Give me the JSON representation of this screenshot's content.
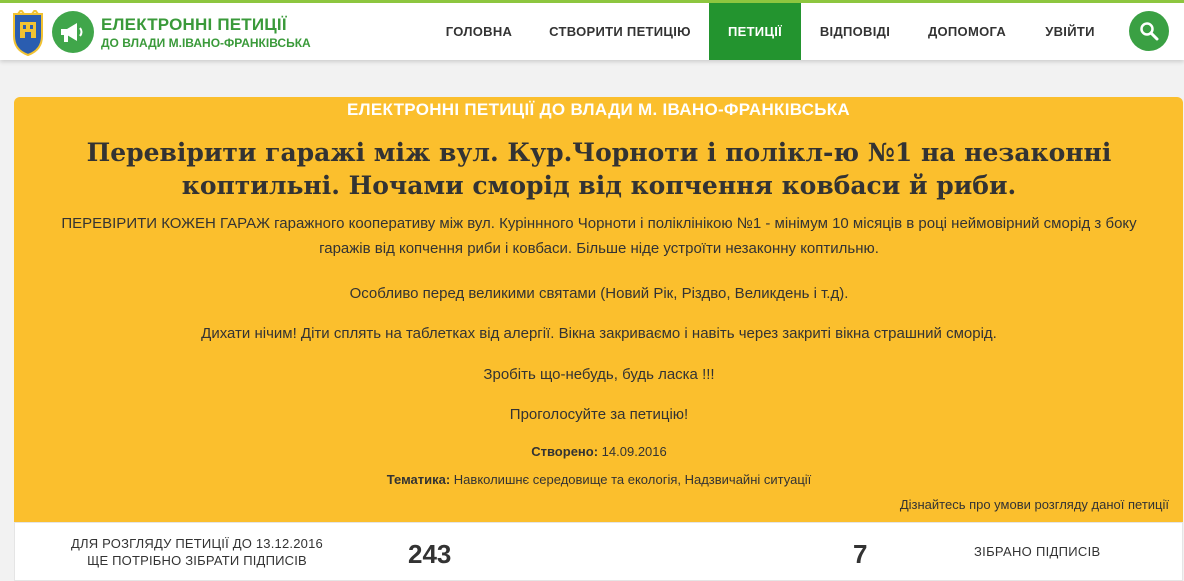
{
  "header": {
    "brand_title": "ЕЛЕКТРОННІ ПЕТИЦІЇ",
    "brand_subtitle": "ДО ВЛАДИ М.ІВАНО-ФРАНКІВСЬКА",
    "nav": [
      {
        "label": "ГОЛОВНА",
        "active": false
      },
      {
        "label": "СТВОРИТИ ПЕТИЦІЮ",
        "active": false
      },
      {
        "label": "ПЕТИЦІЇ",
        "active": true
      },
      {
        "label": "ВІДПОВІДІ",
        "active": false
      },
      {
        "label": "ДОПОМОГА",
        "active": false
      },
      {
        "label": "УВІЙТИ",
        "active": false
      }
    ],
    "search_icon": "search-icon"
  },
  "petition": {
    "section_title": "ЕЛЕКТРОННІ ПЕТИЦІЇ ДО ВЛАДИ М. ІВАНО-ФРАНКІВСЬКА",
    "title": "Перевірити гаражі між вул. Кур.Чорноти і полікл-ю №1 на незаконні коптильні. Ночами сморід від копчення ковбаси й риби.",
    "paragraphs": [
      "ПЕРЕВІРИТИ КОЖЕН ГАРАЖ гаражного кооперативу між вул. Куріннного Чорноти і поліклінікою №1 - мінімум 10 місяців в році неймовірний сморід з боку гаражів від копчення риби і ковбаси. Більше ніде устроїти незаконну коптильню.",
      "Особливо перед великими святами (Новий Рік, Різдво, Великдень і т.д).",
      "Дихати нічим! Діти сплять на таблетках від алергії. Вікна закриваємо і навіть через закриті вікна страшний сморід.",
      "Зробіть що-небудь, будь ласка !!!",
      "Проголосуйте за петицію!"
    ],
    "created_label": "Створено:",
    "created_date": "14.09.2016",
    "topic_label": "Тематика:",
    "topic_value": "Навколишнє середовище та екологія, Надзвичайні ситуації",
    "conditions_link": "Дізнайтесь про умови розгляду даної петиції"
  },
  "signatures": {
    "need_line1": "ДЛЯ РОЗГЛЯДУ ПЕТИЦІЇ ДО 13.12.2016",
    "need_line2": "ЩЕ ПОТРІБНО ЗІБРАТИ ПІДПИСІВ",
    "need_count": "243",
    "collected_count": "7",
    "collected_label": "ЗІБРАНО ПІДПИСІВ"
  },
  "colors": {
    "accent_green": "#23942f",
    "card_yellow": "#fbbf2d"
  }
}
